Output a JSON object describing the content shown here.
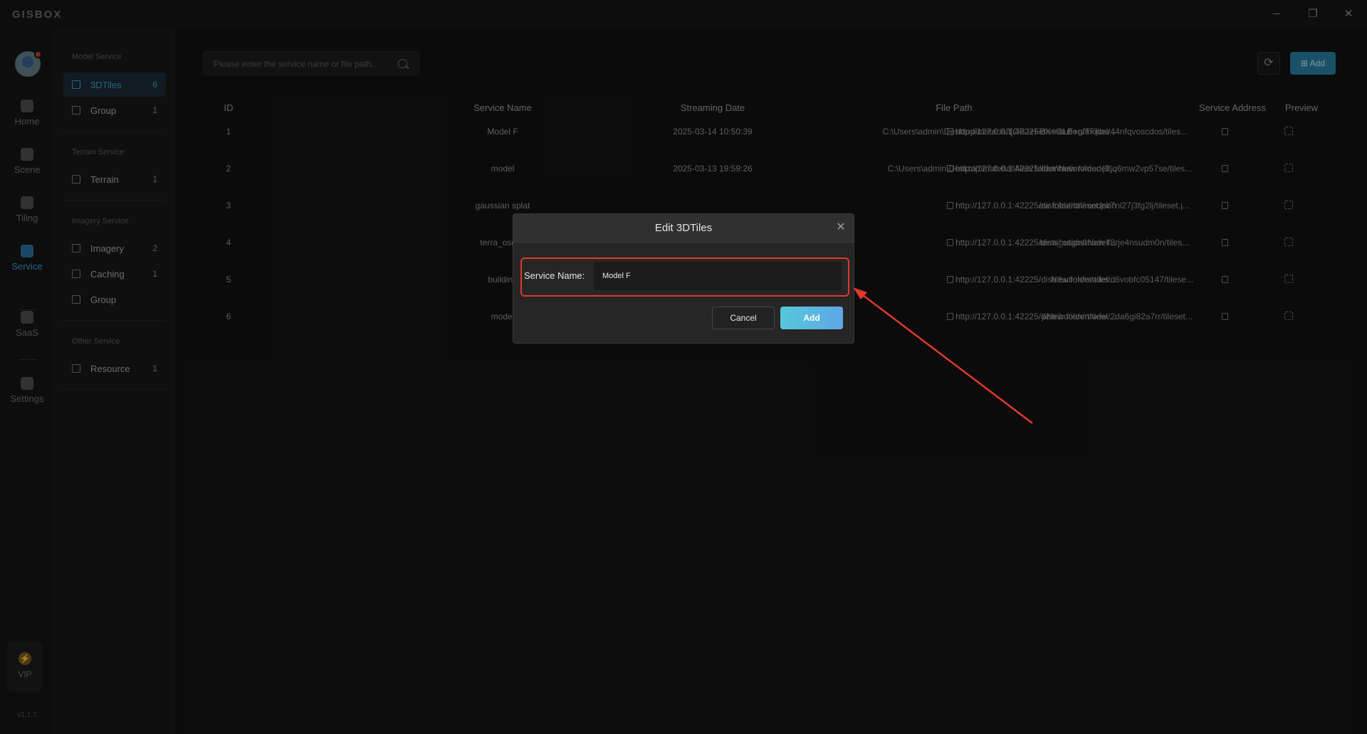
{
  "app": {
    "logo": "GISBOX"
  },
  "window": {
    "minimize": "─",
    "restore": "❐",
    "close": "✕"
  },
  "rail": {
    "items": [
      {
        "label": "Home",
        "icon": "home-icon"
      },
      {
        "label": "Scene",
        "icon": "scene-icon"
      },
      {
        "label": "Tiling",
        "icon": "tiling-icon"
      },
      {
        "label": "Service",
        "icon": "service-icon",
        "active": true
      },
      {
        "label": "SaaS",
        "icon": "saas-icon"
      },
      {
        "label": "Settings",
        "icon": "settings-icon"
      }
    ],
    "vip": {
      "label": "VIP",
      "icon": "lightning-icon",
      "glyph": "⚡"
    },
    "version": "v1.1.7"
  },
  "sidebar": {
    "sections": [
      {
        "title": "Model Service",
        "items": [
          {
            "label": "3DTiles",
            "count": "6",
            "active": true
          },
          {
            "label": "Group",
            "count": "1"
          }
        ]
      },
      {
        "title": "Terrain Service",
        "items": [
          {
            "label": "Terrain",
            "count": "1"
          }
        ]
      },
      {
        "title": "Imagery Service",
        "items": [
          {
            "label": "Imagery",
            "count": "2"
          },
          {
            "label": "Caching",
            "count": "1"
          },
          {
            "label": "Group",
            "count": ""
          }
        ]
      },
      {
        "title": "Other Service",
        "items": [
          {
            "label": "Resource",
            "count": "1"
          }
        ]
      }
    ]
  },
  "toolbar": {
    "search_placeholder": "Please enter the service name or file path.",
    "refresh_glyph": "⟳",
    "add_label": "⊞ Add"
  },
  "table": {
    "headers": {
      "id": "ID",
      "name": "Service Name",
      "date": "Streaming Date",
      "path": "File Path",
      "address": "Service Address",
      "preview": "Preview"
    },
    "rows": [
      {
        "id": "1",
        "name": "Model F",
        "date": "2025-03-14 10:50:39",
        "path": "C:\\Users\\admin\\Desktop\\material\\[OBJ+FBX+GLB+glTF]\\ou...",
        "address": "http://127.0.0.1:42225/distribution/model/44nfqvoscdos/tiles..."
      },
      {
        "id": "2",
        "name": "model",
        "date": "2025-03-13 19:59:26",
        "path": "C:\\Users\\admin\\Desktop\\material\\New folder\\New folder (3...",
        "address": "http://127.0.0.1:42225/distribution/model/jq6mw2vp57se/tiles..."
      },
      {
        "id": "3",
        "name": "gaussian splat",
        "date": "",
        "path": "ew folder\\tileset.json",
        "address": "http://127.0.0.1:42225/distribution/model/7ni27j3fg2lj/tileset.j..."
      },
      {
        "id": "4",
        "name": "terra_osgbs",
        "date": "",
        "path": "terra_osgbs\\New f...",
        "address": "http://127.0.0.1:42225/distribution/model/8rje4nsudm0n/tiles..."
      },
      {
        "id": "5",
        "name": "building",
        "date": "",
        "path": "New folder\\tiles...",
        "address": "http://127.0.0.1:42225/distribution/model/d6vobfc05147/tilese..."
      },
      {
        "id": "6",
        "name": "model",
        "date": "",
        "path": ")\\New folder\\New ...",
        "address": "http://127.0.0.1:42225/distribution/model/2da6gi82a7rr/tileset..."
      }
    ]
  },
  "dialog": {
    "title": "Edit 3DTiles",
    "close_glyph": "✕",
    "field_label": "Service Name:",
    "field_value": "Model F",
    "cancel_label": "Cancel",
    "confirm_label": "Add"
  },
  "colors": {
    "accent": "#3d9bd4",
    "highlight": "#e0392b",
    "confirm_start": "#56c8d8",
    "confirm_end": "#5ea7e8"
  }
}
